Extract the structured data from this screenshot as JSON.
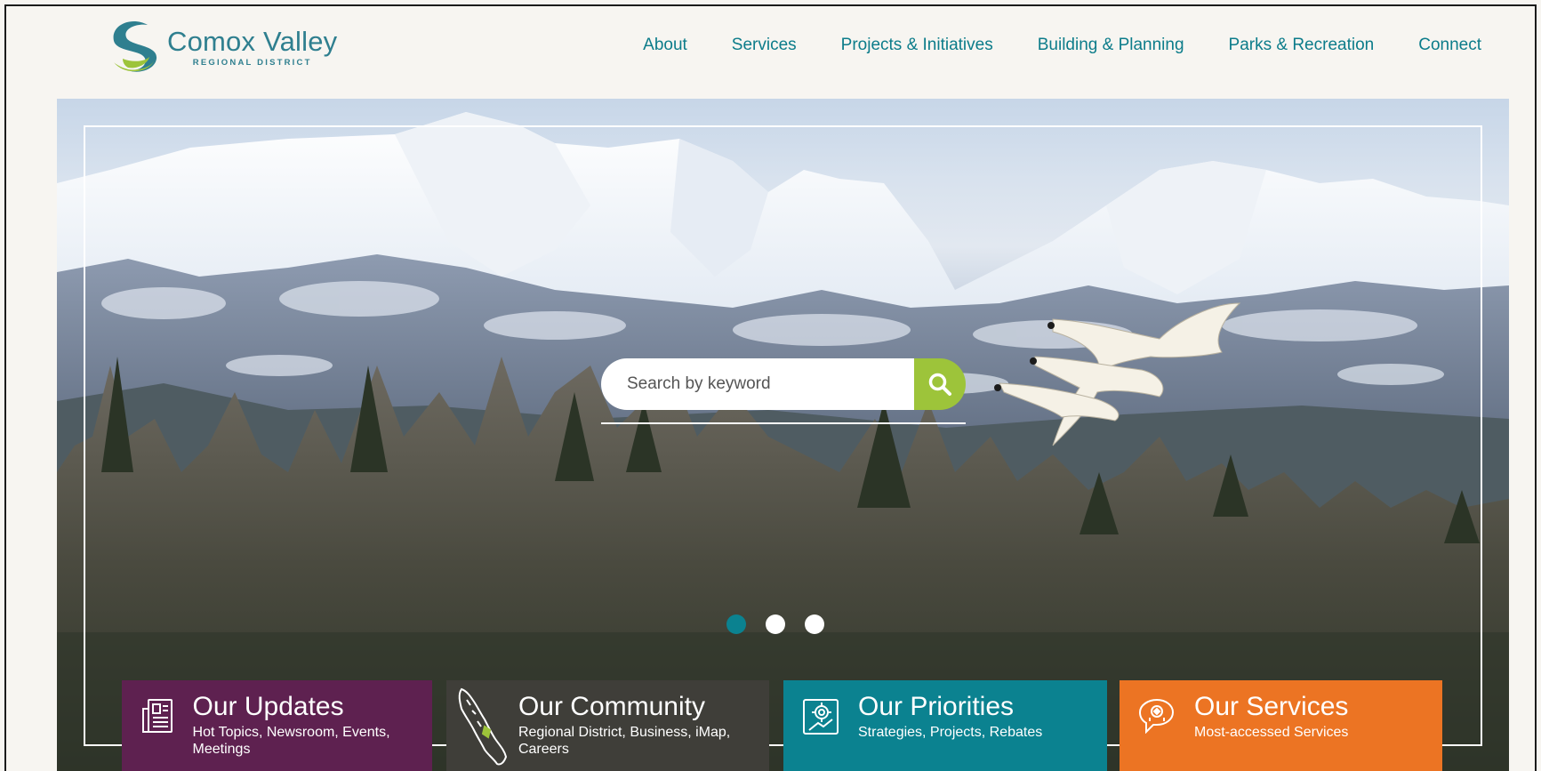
{
  "logo": {
    "title": "Comox Valley",
    "subtitle": "REGIONAL DISTRICT"
  },
  "nav": [
    {
      "label": "About"
    },
    {
      "label": "Services"
    },
    {
      "label": "Projects & Initiatives"
    },
    {
      "label": "Building & Planning"
    },
    {
      "label": "Parks & Recreation"
    },
    {
      "label": "Connect"
    }
  ],
  "search": {
    "placeholder": "Search by keyword",
    "icon": "search-icon"
  },
  "carousel": {
    "slides": 3,
    "active": 1
  },
  "tiles": [
    {
      "title": "Our Updates",
      "subtitle": "Hot Topics, Newsroom, Events, Meetings",
      "icon": "newspaper-icon",
      "color": "#5e2150"
    },
    {
      "title": "Our Community",
      "subtitle": "Regional District, Business, iMap, Careers",
      "icon": "map-icon",
      "color": "#3f3e39"
    },
    {
      "title": "Our Priorities",
      "subtitle": "Strategies, Projects, Rebates",
      "icon": "priorities-icon",
      "color": "#0b8290"
    },
    {
      "title": "Our Services",
      "subtitle": "Most-accessed Services",
      "icon": "services-icon",
      "color": "#ec7423"
    }
  ],
  "colors": {
    "accent": "#0c7c8a",
    "search_button": "#9dc43a",
    "logo_green": "#9dc43a",
    "logo_blue": "#2f7f8f"
  }
}
